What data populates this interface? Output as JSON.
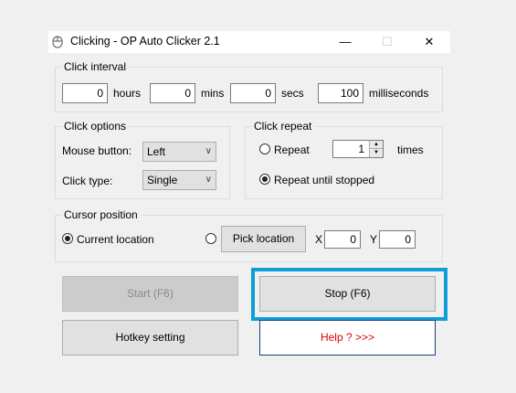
{
  "window": {
    "title": "Clicking - OP Auto Clicker 2.1",
    "minimize": "—",
    "maximize": "☐",
    "close": "✕"
  },
  "click_interval": {
    "title": "Click interval",
    "hours_value": "0",
    "hours_label": "hours",
    "mins_value": "0",
    "mins_label": "mins",
    "secs_value": "0",
    "secs_label": "secs",
    "ms_value": "100",
    "ms_label": "milliseconds"
  },
  "click_options": {
    "title": "Click options",
    "mouse_button_label": "Mouse button:",
    "mouse_button_value": "Left",
    "click_type_label": "Click type:",
    "click_type_value": "Single"
  },
  "click_repeat": {
    "title": "Click repeat",
    "repeat_label": "Repeat",
    "repeat_value": "1",
    "times_label": "times",
    "repeat_until_label": "Repeat until stopped",
    "selected": "repeat_until_stopped"
  },
  "cursor_position": {
    "title": "Cursor position",
    "current_location_label": "Current location",
    "pick_location_label": "Pick location",
    "x_label": "X",
    "x_value": "0",
    "y_label": "Y",
    "y_value": "0",
    "selected": "current_location"
  },
  "buttons": {
    "start": "Start (F6)",
    "stop": "Stop (F6)",
    "hotkey": "Hotkey setting",
    "help": "Help ?  >>>"
  },
  "colors": {
    "highlight": "#0f9fd8",
    "help_text": "#e00000"
  }
}
